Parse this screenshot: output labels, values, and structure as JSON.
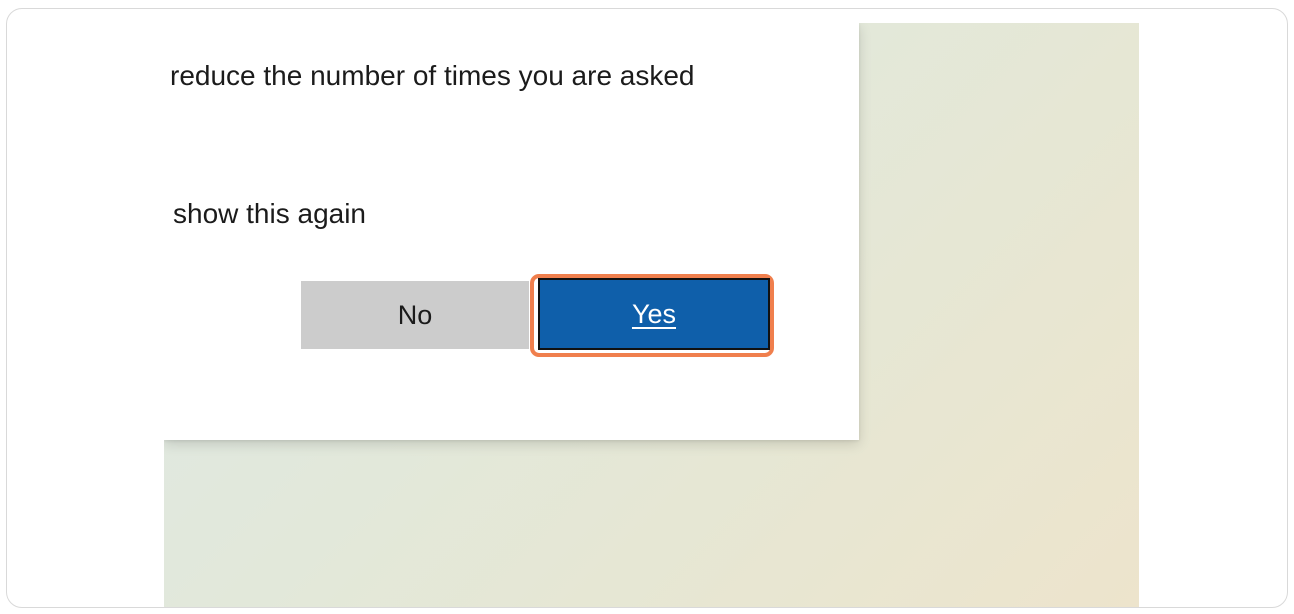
{
  "dialog": {
    "line_reduce": "reduce the number of times you are asked",
    "line_show": "show this again"
  },
  "buttons": {
    "no_label": "No",
    "yes_label": "Yes"
  },
  "colors": {
    "yes_button": "#0f5faa",
    "no_button": "#cccccc",
    "highlight_outline": "#f07f4d"
  }
}
